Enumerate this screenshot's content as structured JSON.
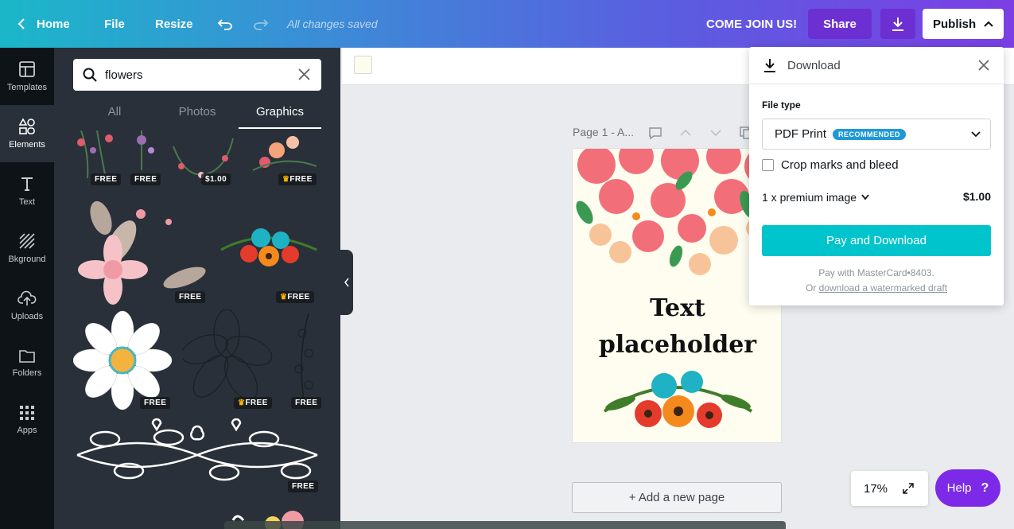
{
  "topbar": {
    "home": "Home",
    "file": "File",
    "resize": "Resize",
    "saved_status": "All changes saved",
    "cta": "COME JOIN US!",
    "share": "Share",
    "publish": "Publish"
  },
  "rail": {
    "items": [
      {
        "label": "Templates",
        "icon": "templates-icon"
      },
      {
        "label": "Elements",
        "icon": "elements-icon"
      },
      {
        "label": "Text",
        "icon": "text-icon"
      },
      {
        "label": "Bkground",
        "icon": "background-icon"
      },
      {
        "label": "Uploads",
        "icon": "uploads-icon"
      },
      {
        "label": "Folders",
        "icon": "folder-icon"
      },
      {
        "label": "Apps",
        "icon": "apps-icon"
      }
    ]
  },
  "panel": {
    "search_value": "flowers",
    "tabs": [
      "All",
      "Photos",
      "Graphics"
    ],
    "badges": [
      "FREE",
      "FREE",
      "$1.00",
      "FREE",
      "FREE",
      "FREE",
      "FREE",
      "FREE",
      "FREE",
      "FREE"
    ]
  },
  "canvas": {
    "page_label": "Page 1 - A...",
    "page_text_line1": "Text",
    "page_text_line2": "placeholder",
    "add_page": "+ Add a new page",
    "zoom": "17%",
    "help": "Help",
    "help_mark": "?"
  },
  "download": {
    "title": "Download",
    "file_type_label": "File type",
    "file_type_value": "PDF Print",
    "recommended": "RECOMMENDED",
    "crop_label": "Crop marks and bleed",
    "premium_label": "1 x premium image",
    "price": "$1.00",
    "pay_button": "Pay and Download",
    "pay_note": "Pay with MasterCard•8403.",
    "or": "Or",
    "watermark_link": "download a watermarked draft"
  },
  "colors": {
    "accent_teal": "#00c4cc",
    "accent_purple": "#7d2ae8",
    "rail_bg": "#0e1318",
    "panel_bg": "#293039"
  }
}
